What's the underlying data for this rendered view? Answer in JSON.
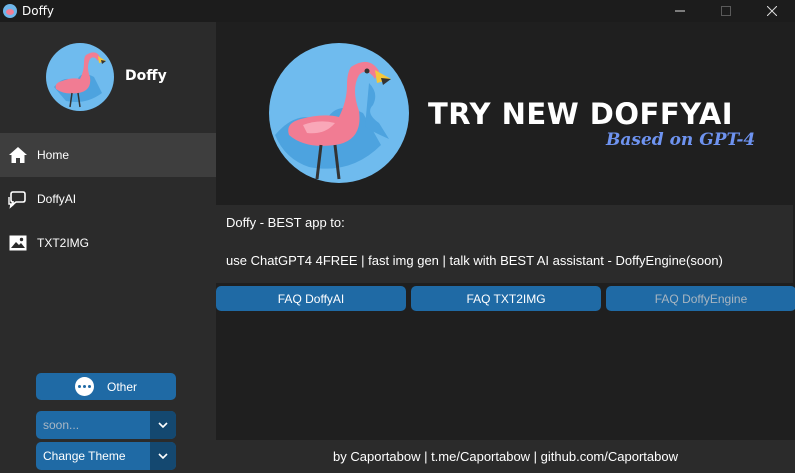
{
  "window": {
    "title": "Doffy",
    "minimize_icon": "minimize-icon",
    "maximize_icon": "maximize-icon",
    "close_icon": "close-icon"
  },
  "sidebar": {
    "brand": "Doffy",
    "logo_icon": "flamingo-logo",
    "items": [
      {
        "label": "Home",
        "icon": "home-icon",
        "active": true
      },
      {
        "label": "DoffyAI",
        "icon": "chat-bubbles-icon",
        "active": false
      },
      {
        "label": "TXT2IMG",
        "icon": "image-icon",
        "active": false
      }
    ],
    "other_button": {
      "label": "Other",
      "icon": "more-dots-icon"
    },
    "soon_combo": {
      "value": "soon..."
    },
    "theme_combo": {
      "value": "Change Theme"
    }
  },
  "banner": {
    "title": "TRY NEW DOFFYAI",
    "subtitle": "Based on GPT-4",
    "subtitle_color": "#6e93f0"
  },
  "info": {
    "line1": "Doffy - BEST app to:",
    "line2": "use ChatGPT4 4FREE | fast img gen | talk with BEST AI assistant - DoffyEngine(soon)"
  },
  "faq_buttons": [
    {
      "label": "FAQ DoffyAI",
      "enabled": true
    },
    {
      "label": "FAQ TXT2IMG",
      "enabled": true
    },
    {
      "label": "FAQ DoffyEngine",
      "enabled": false
    }
  ],
  "footer": {
    "text": "by Caportabow | t.me/Caportabow | github.com/Caportabow"
  },
  "colors": {
    "accent": "#1f6aa5",
    "accent_dark": "#144870",
    "sidebar_bg": "#2b2b2b",
    "main_bg": "#1f1f1f",
    "active_item": "#3e3e3e"
  }
}
